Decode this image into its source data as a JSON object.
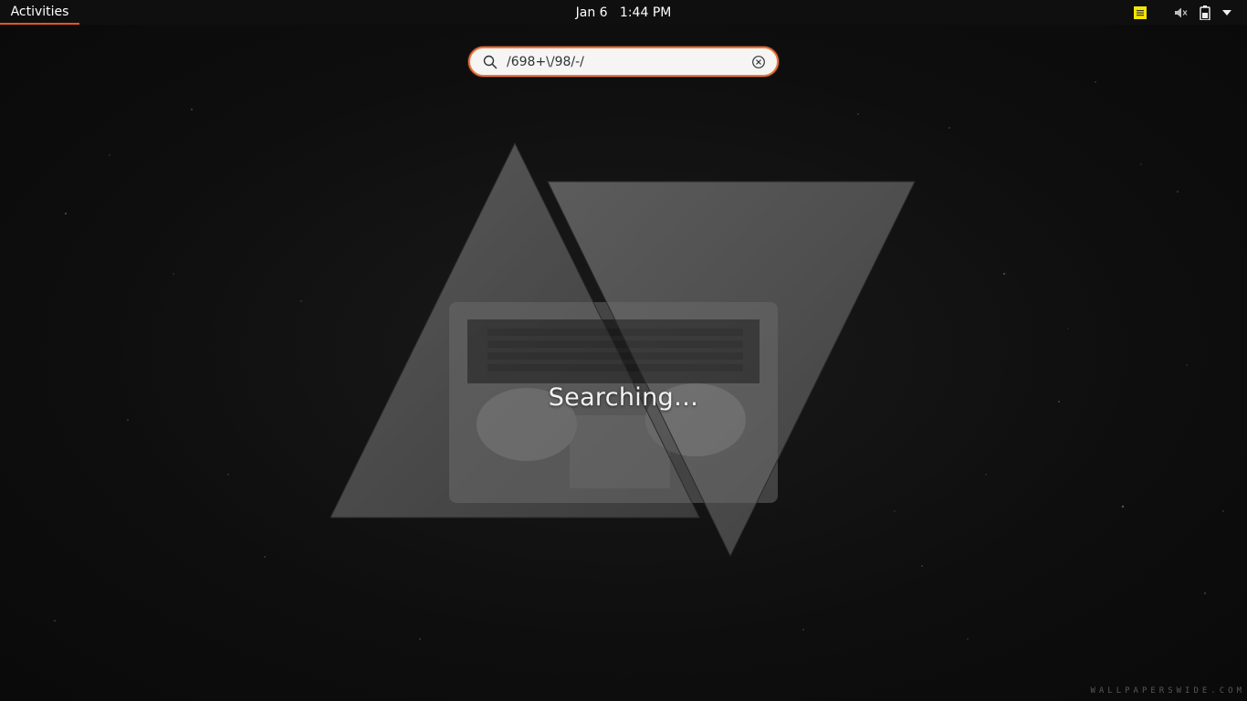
{
  "topbar": {
    "activities_label": "Activities",
    "clock": "Jan 6   1:44 PM",
    "tray_icons": [
      "sticky-notes-icon",
      "volume-muted-icon",
      "battery-icon",
      "system-menu-arrow-icon"
    ]
  },
  "search": {
    "value": "/698+\\/98/-/",
    "accent_color": "#e95420"
  },
  "overview": {
    "status_text": "Searching…"
  },
  "wallpaper": {
    "watermark": "WALLPAPERSWIDE.COM"
  }
}
